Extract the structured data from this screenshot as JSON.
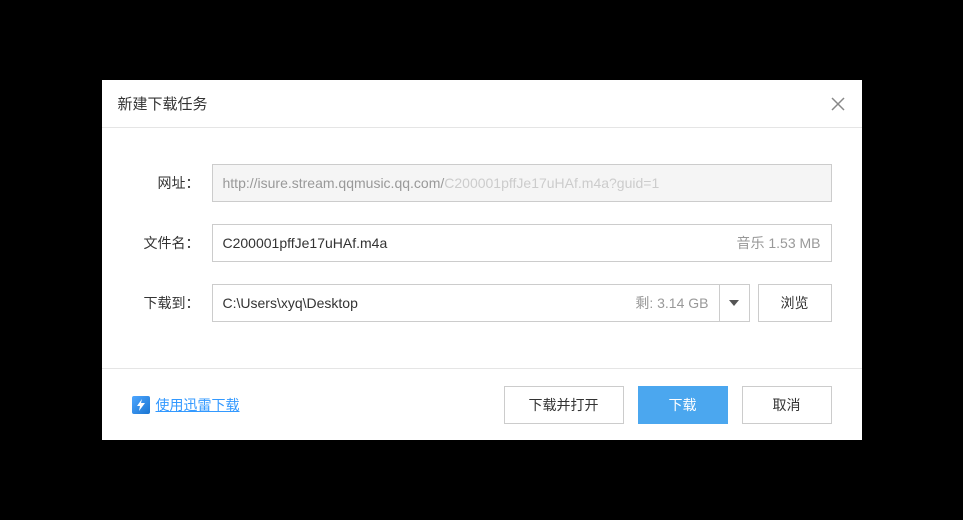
{
  "dialog": {
    "title": "新建下载任务"
  },
  "form": {
    "url": {
      "label": "网址：",
      "value_dark": "http://isure.stream.qqmusic.qq.com/",
      "value_light": "C200001pffJe17uHAf.m4a?guid=1"
    },
    "filename": {
      "label": "文件名：",
      "value": "C200001pffJe17uHAf.m4a",
      "type_label": "音乐",
      "size": "1.53 MB"
    },
    "saveto": {
      "label": "下载到：",
      "value": "C:\\Users\\xyq\\Desktop",
      "free_space": "剩: 3.14 GB",
      "browse_label": "浏览"
    }
  },
  "footer": {
    "thunder_label": "使用迅雷下载",
    "download_open_label": "下载并打开",
    "download_label": "下载",
    "cancel_label": "取消"
  }
}
